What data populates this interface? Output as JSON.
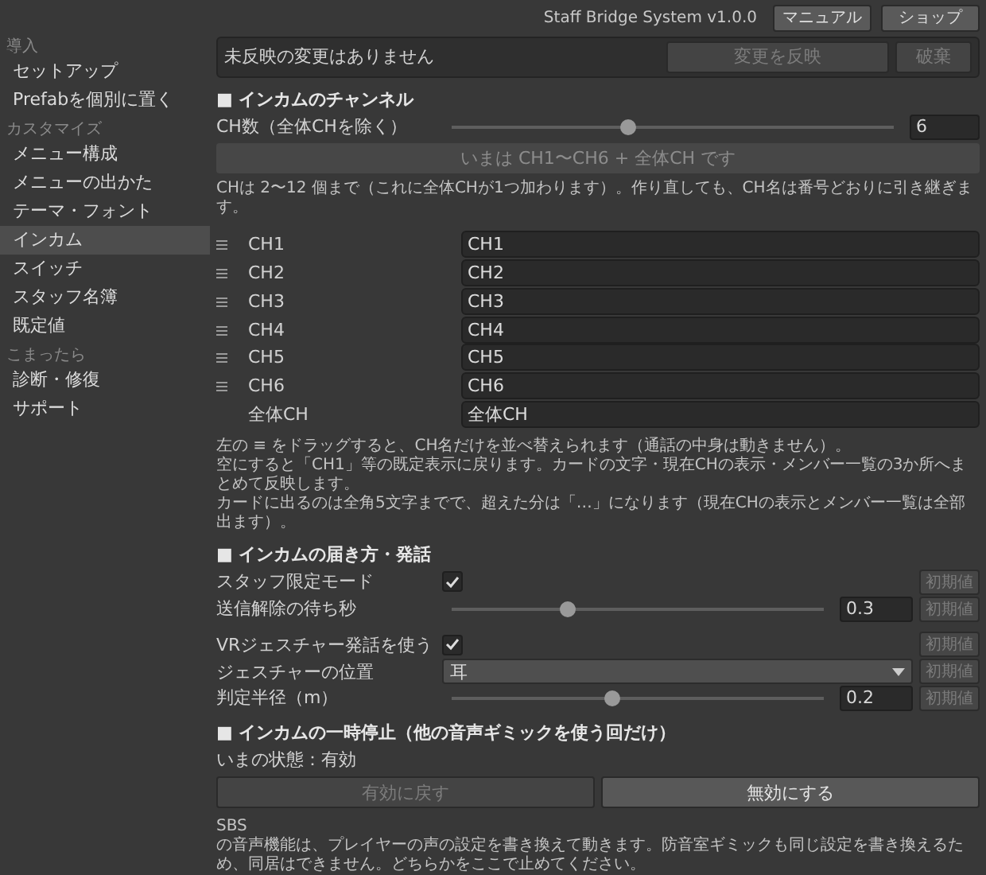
{
  "header": {
    "title": "Staff Bridge System v1.0.0",
    "buttons": [
      "マニュアル",
      "ショップ"
    ]
  },
  "sidebar": {
    "groups": [
      {
        "heading": "導入",
        "items": [
          {
            "label": "セットアップ",
            "selected": false
          },
          {
            "label": "Prefabを個別に置く",
            "selected": false
          }
        ]
      },
      {
        "heading": "カスタマイズ",
        "items": [
          {
            "label": "メニュー構成",
            "selected": false
          },
          {
            "label": "メニューの出かた",
            "selected": false
          },
          {
            "label": "テーマ・フォント",
            "selected": false
          },
          {
            "label": "インカム",
            "selected": true
          },
          {
            "label": "スイッチ",
            "selected": false
          },
          {
            "label": "スタッフ名簿",
            "selected": false
          },
          {
            "label": "既定値",
            "selected": false
          }
        ]
      },
      {
        "heading": "こまったら",
        "items": [
          {
            "label": "診断・修復",
            "selected": false
          },
          {
            "label": "サポート",
            "selected": false
          }
        ]
      }
    ]
  },
  "status_bar": {
    "message": "未反映の変更はありません",
    "buttons": [
      {
        "label": "変更を反映",
        "disabled": true
      },
      {
        "label": "破棄",
        "disabled": true
      }
    ]
  },
  "channel_section": {
    "title": "■ インカムのチャンネル",
    "count": {
      "label": "CH数（全体CHを除く）",
      "level": 0.4,
      "value": "6"
    },
    "summary": "いまは CH1〜CH6 + 全体CH です",
    "note": "CHは 2〜12 個まで（これに全体CHが1つ加わります）。作り直しても、CH名は番号どおりに引き継ぎます。",
    "channels": [
      {
        "name": "CH1",
        "value": "CH1",
        "draggable": true
      },
      {
        "name": "CH2",
        "value": "CH2",
        "draggable": true
      },
      {
        "name": "CH3",
        "value": "CH3",
        "draggable": true
      },
      {
        "name": "CH4",
        "value": "CH4",
        "draggable": true
      },
      {
        "name": "CH5",
        "value": "CH5",
        "draggable": true
      },
      {
        "name": "CH6",
        "value": "CH6",
        "draggable": true
      },
      {
        "name": "全体CH",
        "value": "全体CH",
        "draggable": false
      }
    ],
    "notes": [
      "左の ≡ をドラッグすると、CH名だけを並べ替えられます（通話の中身は動きません）。",
      "空にすると「CH1」等の既定表示に戻ります。カードの文字・現在CHの表示・メンバー一覧の3か所へまとめて反映します。",
      "カードに出るのは全角5文字までで、超えた分は「…」になります（現在CHの表示とメンバー一覧は全部出ます）。"
    ]
  },
  "delivery_section": {
    "title": "■ インカムの届き方・発話",
    "groups": [
      [
        {
          "kind": "checkbox",
          "label": "スタッフ限定モード",
          "checked": true,
          "reset": "初期値"
        },
        {
          "kind": "slider",
          "label": "送信解除の待ち秒",
          "level": 0.31,
          "value": "0.3",
          "reset": "初期値"
        }
      ],
      [
        {
          "kind": "checkbox",
          "label": "VRジェスチャー発話を使う",
          "checked": true,
          "reset": "初期値"
        },
        {
          "kind": "dropdown",
          "label": "ジェスチャーの位置",
          "value": "耳",
          "reset": "初期値"
        },
        {
          "kind": "slider",
          "label": "判定半径（m）",
          "level": 0.43,
          "value": "0.2",
          "reset": "初期値"
        }
      ]
    ]
  },
  "pause_section": {
    "title": "■ インカムの一時停止（他の音声ギミックを使う回だけ）",
    "status": "いまの状態：有効",
    "buttons": [
      {
        "label": "有効に戻す",
        "disabled": true
      },
      {
        "label": "無効にする",
        "disabled": false
      }
    ],
    "note_lines": [
      "SBS",
      "の音声機能は、プレイヤーの声の設定を書き換えて動きます。防音室ギミックも同じ設定を書き換えるため、同居はできません。どちらかをここで止めてください。"
    ]
  }
}
